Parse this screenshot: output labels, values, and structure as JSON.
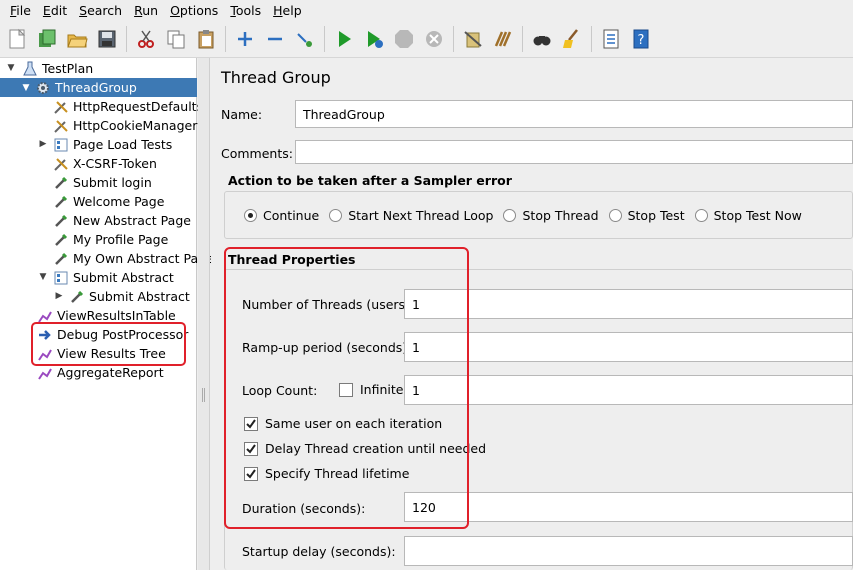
{
  "menu": [
    {
      "key": "F",
      "rest": "ile"
    },
    {
      "key": "E",
      "rest": "dit"
    },
    {
      "key": "S",
      "rest": "earch"
    },
    {
      "key": "R",
      "rest": "un"
    },
    {
      "key": "O",
      "rest": "ptions"
    },
    {
      "key": "T",
      "rest": "ools"
    },
    {
      "key": "H",
      "rest": "elp"
    }
  ],
  "toolbar": {
    "icons": [
      "new-icon",
      "templates-icon",
      "open-icon",
      "save-icon",
      "cut-icon",
      "copy-icon",
      "paste-icon",
      "expand-icon",
      "collapse-icon",
      "toggle-icon",
      "start-icon",
      "start-no-pauses-icon",
      "stop-icon",
      "shutdown-icon",
      "clear-icon",
      "clear-all-icon",
      "search-icon",
      "reset-search-icon",
      "function-helper-icon",
      "help-icon"
    ]
  },
  "tree": {
    "items": [
      {
        "label": "TestPlan"
      },
      {
        "label": "ThreadGroup"
      },
      {
        "label": "HttpRequestDefaults"
      },
      {
        "label": "HttpCookieManager"
      },
      {
        "label": "Page Load Tests"
      },
      {
        "label": "X-CSRF-Token"
      },
      {
        "label": "Submit login"
      },
      {
        "label": "Welcome Page"
      },
      {
        "label": "New Abstract Page"
      },
      {
        "label": "My Profile Page"
      },
      {
        "label": "My Own Abstract Page"
      },
      {
        "label": "Submit Abstract"
      },
      {
        "label": "Submit Abstract"
      },
      {
        "label": "ViewResultsInTable"
      },
      {
        "label": "Debug PostProcessor"
      },
      {
        "label": "View Results Tree"
      },
      {
        "label": "AggregateReport"
      }
    ]
  },
  "panel": {
    "title": "Thread Group",
    "name_label": "Name:",
    "name_value": "ThreadGroup",
    "comments_label": "Comments:",
    "comments_value": "",
    "error_action": {
      "title": "Action to be taken after a Sampler error",
      "options": [
        "Continue",
        "Start Next Thread Loop",
        "Stop Thread",
        "Stop Test",
        "Stop Test Now"
      ],
      "selected": "Continue"
    },
    "thread_props": {
      "title": "Thread Properties",
      "threads_label": "Number of Threads (users):",
      "threads_value": "1",
      "rampup_label": "Ramp-up period (seconds):",
      "rampup_value": "1",
      "loop_label": "Loop Count:",
      "infinite_label": "Infinite",
      "infinite_checked": false,
      "loop_value": "1",
      "same_user_label": "Same user on each iteration",
      "same_user_checked": true,
      "delay_label": "Delay Thread creation until needed",
      "delay_checked": true,
      "lifetime_label": "Specify Thread lifetime",
      "lifetime_checked": true,
      "duration_label": "Duration (seconds):",
      "duration_value": "120",
      "startup_label": "Startup delay (seconds):",
      "startup_value": ""
    }
  },
  "colors": {
    "selection": "#3d79b4",
    "highlight": "#e0202a"
  }
}
